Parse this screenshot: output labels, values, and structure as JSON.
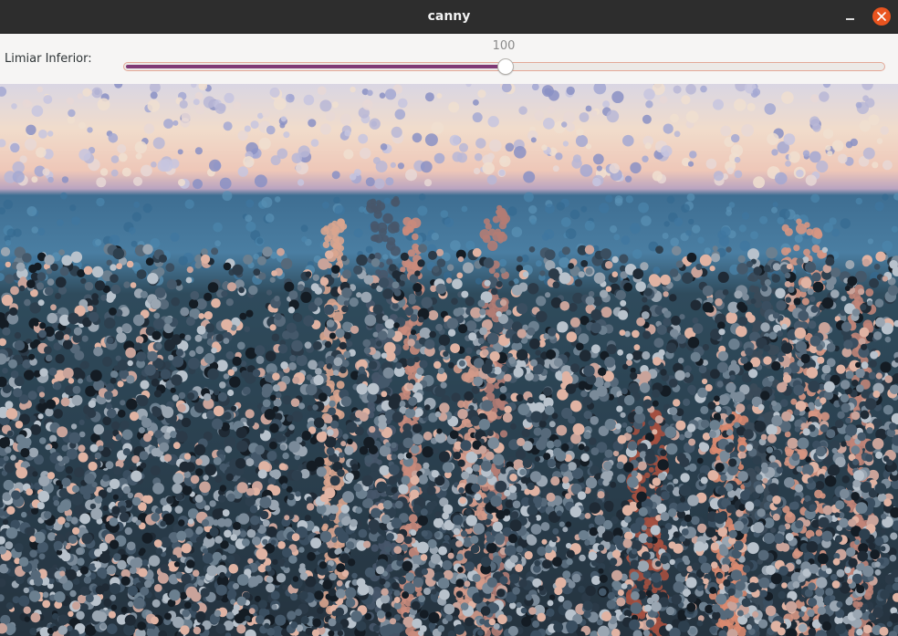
{
  "window": {
    "title": "canny"
  },
  "trackbar": {
    "label": "Limiar Inferior:",
    "value_text": "100",
    "value": 100,
    "fraction": 0.502
  },
  "image": {
    "description_name": "city-skyline-painting",
    "colors": {
      "sky_top": "#d9d6e3",
      "sky_glow": "#f1dccb",
      "sea": "#3e6e92",
      "city_dark": "#25333f",
      "building_highlight": "#e0a090"
    }
  },
  "icons": {
    "close": "close-icon",
    "minimize": "minimize-icon"
  }
}
